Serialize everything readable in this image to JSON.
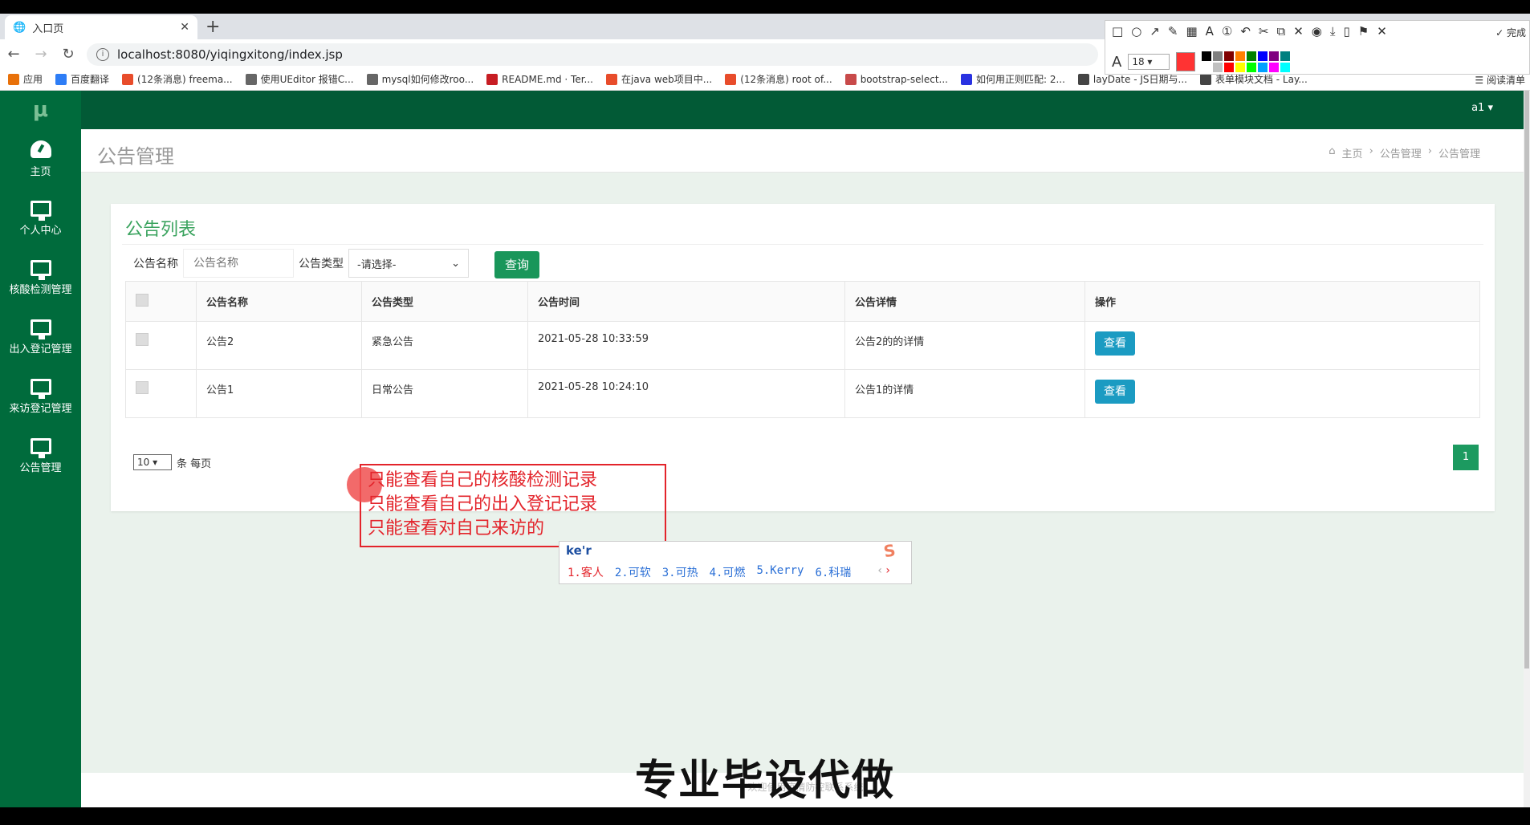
{
  "browser": {
    "tab_title": "入口页",
    "url": "localhost:8080/yiqingxitong/index.jsp",
    "bookmarks": [
      {
        "label": "应用",
        "color": "#e8710a"
      },
      {
        "label": "百度翻译",
        "color": "#2d7df6"
      },
      {
        "label": "(12条消息) freema...",
        "color": "#e84c2b"
      },
      {
        "label": "使用UEditor 报错C...",
        "color": "#666666"
      },
      {
        "label": "mysql如何修改roo...",
        "color": "#666666"
      },
      {
        "label": "README.md · Ter...",
        "color": "#c71d23"
      },
      {
        "label": "在java web项目中...",
        "color": "#e84c2b"
      },
      {
        "label": "(12条消息) root of...",
        "color": "#e84c2b"
      },
      {
        "label": "bootstrap-select...",
        "color": "#c84a4a"
      },
      {
        "label": "如何用正则匹配: 2...",
        "color": "#2932e1"
      },
      {
        "label": "layDate - JS日期与...",
        "color": "#444444"
      },
      {
        "label": "表单模块文档 - Lay...",
        "color": "#444444"
      }
    ],
    "reading_list": "阅读清单"
  },
  "snaptool": {
    "font_size": "18",
    "current_color": "#ff3333",
    "done_label": "完成",
    "palette": [
      "#000000",
      "#808080",
      "#800000",
      "#ff8000",
      "#008000",
      "#0000ff",
      "#800080",
      "#008080",
      "#ffffff",
      "#c0c0c0",
      "#ff0000",
      "#ffff00",
      "#00ff00",
      "#00a0ff",
      "#ff00ff",
      "#00ffff"
    ]
  },
  "app": {
    "logo": "μ",
    "user": "a1 ▾",
    "sidebar": [
      {
        "label": "主页",
        "icon": "dashboard-icon"
      },
      {
        "label": "个人中心",
        "icon": "monitor-icon"
      },
      {
        "label": "核酸检测管理",
        "icon": "monitor-icon"
      },
      {
        "label": "出入登记管理",
        "icon": "monitor-icon"
      },
      {
        "label": "来访登记管理",
        "icon": "monitor-icon"
      },
      {
        "label": "公告管理",
        "icon": "monitor-icon"
      }
    ],
    "page_title": "公告管理",
    "breadcrumb": [
      "主页",
      "公告管理",
      "公告管理"
    ],
    "panel_title": "公告列表",
    "search": {
      "name_label": "公告名称",
      "name_placeholder": "公告名称",
      "type_label": "公告类型",
      "type_value": "-请选择-",
      "query_button": "查询"
    },
    "table": {
      "headers": [
        "",
        "公告名称",
        "公告类型",
        "公告时间",
        "公告详情",
        "操作"
      ],
      "rows": [
        {
          "name": "公告2",
          "type": "紧急公告",
          "time": "2021-05-28 10:33:59",
          "detail": "公告2的的详情",
          "action": "查看"
        },
        {
          "name": "公告1",
          "type": "日常公告",
          "time": "2021-05-28 10:24:10",
          "detail": "公告1的详情",
          "action": "查看"
        }
      ]
    },
    "pagination": {
      "per_page": "10",
      "per_page_suffix": "条 每页",
      "current_page": "1"
    },
    "footer": "欢迎使用疫情防控联系系统"
  },
  "annotation": {
    "lines": [
      "只能查看自己的核酸检测记录",
      "只能查看自己的出入登记记录",
      "只能查看对自己来访的"
    ]
  },
  "ime": {
    "composition": "ke'r",
    "candidates": [
      "1.客人",
      "2.可软",
      "3.可热",
      "4.可燃",
      "5.Kerry",
      "6.科瑞"
    ]
  },
  "watermark": "专业毕设代做"
}
